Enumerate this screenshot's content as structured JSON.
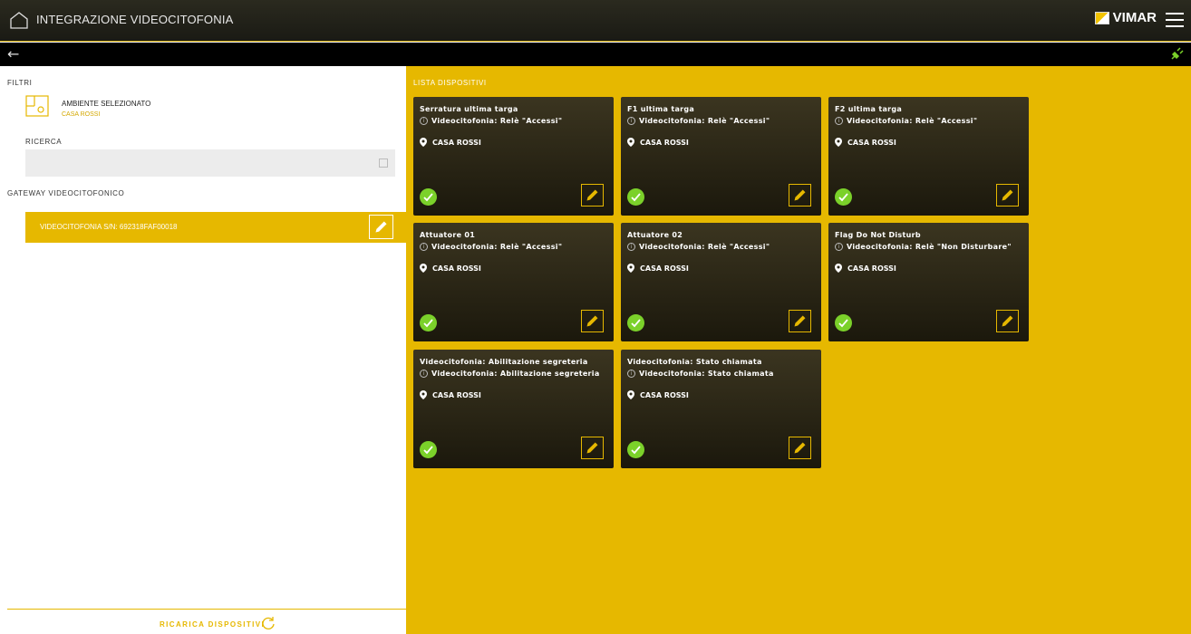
{
  "header": {
    "title": "INTEGRAZIONE VIDEOCITOFONIA",
    "logo_text": "VIMAR"
  },
  "filters": {
    "label": "FILTRI",
    "ambiente_label": "AMBIENTE SELEZIONATO",
    "ambiente_value": "CASA ROSSI",
    "ricerca_label": "RICERCA",
    "ricerca_value": "",
    "gateway_label": "GATEWAY VIDEOCITOFONICO",
    "gateway_item": "VIDEOCITOFONIA S/N: 692318FAF00018"
  },
  "footer": {
    "reload_label": "RICARICA DISPOSITIVI"
  },
  "devices": {
    "heading": "LISTA DISPOSITIVI",
    "items": [
      {
        "name": "Serratura ultima targa",
        "type": "Videocitofonia: Relè \"Accessi\"",
        "location": "CASA ROSSI"
      },
      {
        "name": "F1 ultima targa",
        "type": "Videocitofonia: Relè \"Accessi\"",
        "location": "CASA ROSSI"
      },
      {
        "name": "F2 ultima targa",
        "type": "Videocitofonia: Relè \"Accessi\"",
        "location": "CASA ROSSI"
      },
      {
        "name": "Attuatore 01",
        "type": "Videocitofonia: Relè \"Accessi\"",
        "location": "CASA ROSSI"
      },
      {
        "name": "Attuatore 02",
        "type": "Videocitofonia: Relè \"Accessi\"",
        "location": "CASA ROSSI"
      },
      {
        "name": "Flag Do Not Disturb",
        "type": "Videocitofonia: Relè \"Non Disturbare\"",
        "location": "CASA ROSSI"
      },
      {
        "name": "Videocitofonia: Abilitazione segreteria",
        "type": "Videocitofonia: Abilitazione segreteria",
        "location": "CASA ROSSI"
      },
      {
        "name": "Videocitofonia: Stato chiamata",
        "type": "Videocitofonia: Stato chiamata",
        "location": "CASA ROSSI"
      }
    ]
  },
  "colors": {
    "accent": "#e6b800",
    "card_bg": "#2a2616",
    "status_ok": "#7bd12a"
  }
}
